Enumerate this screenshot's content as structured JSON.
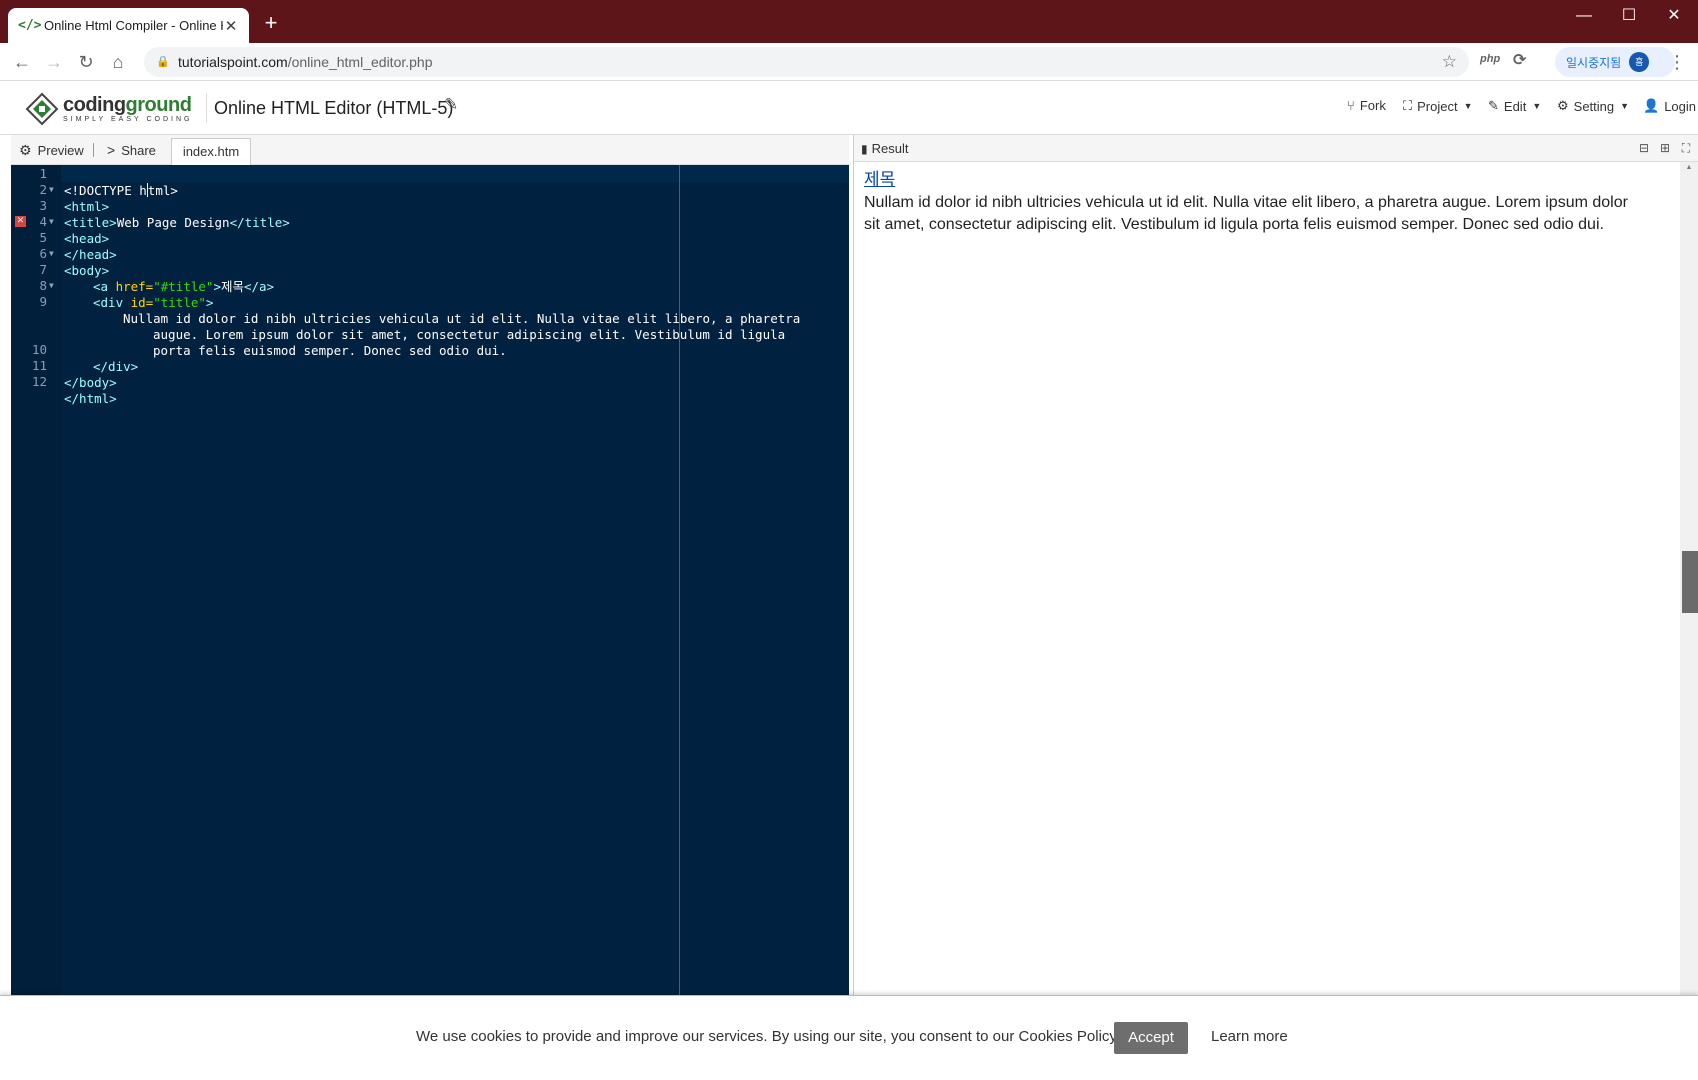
{
  "browser": {
    "tab_title": "Online Html Compiler - Online H",
    "url_domain": "tutorialspoint.com",
    "url_path": "/online_html_editor.php",
    "profile_label": "일시중지됨",
    "profile_avatar": "흠",
    "extension_label": "php"
  },
  "header": {
    "logo_main": "coding",
    "logo_accent": "ground",
    "logo_tagline": "SIMPLY EASY CODING",
    "page_title": "Online HTML Editor (HTML-5)",
    "menu": {
      "fork": "Fork",
      "project": "Project",
      "edit": "Edit",
      "setting": "Setting",
      "login": "Login"
    }
  },
  "editor": {
    "preview_label": "Preview",
    "share_label": "Share",
    "file_tab": "index.htm",
    "lines": [
      {
        "n": "1",
        "fold": false,
        "error": false
      },
      {
        "n": "2",
        "fold": true,
        "error": false
      },
      {
        "n": "3",
        "fold": false,
        "error": false
      },
      {
        "n": "4",
        "fold": true,
        "error": true
      },
      {
        "n": "5",
        "fold": false,
        "error": false
      },
      {
        "n": "6",
        "fold": true,
        "error": false
      },
      {
        "n": "7",
        "fold": false,
        "error": false
      },
      {
        "n": "8",
        "fold": true,
        "error": false
      },
      {
        "n": "9",
        "fold": false,
        "error": false
      },
      {
        "n": "10",
        "fold": false,
        "error": false
      },
      {
        "n": "11",
        "fold": false,
        "error": false
      },
      {
        "n": "12",
        "fold": false,
        "error": false
      }
    ],
    "code": {
      "l1a": "<!DOCTYPE h",
      "l1b": "tml>",
      "l2": "<html>",
      "l3_open": "<title>",
      "l3_text": "Web Page Design",
      "l3_close": "</title>",
      "l4": "<head>",
      "l5": "</head>",
      "l6": "<body>",
      "l7_open": "<a ",
      "l7_attr": "href=",
      "l7_val": "\"#title\"",
      "l7_gt": ">",
      "l7_text": "제목",
      "l7_close": "</a>",
      "l8_open": "<div ",
      "l8_attr": "id=",
      "l8_val": "\"title\"",
      "l8_gt": ">",
      "l9_a": "Nullam id dolor id nibh ultricies vehicula ut id elit. Nulla vitae elit libero, a pharetra",
      "l9_b": "augue. Lorem ipsum dolor sit amet, consectetur adipiscing elit. Vestibulum id ligula",
      "l9_c": "porta felis euismod semper. Donec sed odio dui.",
      "l10": "</div>",
      "l11": "</body>",
      "l12": "</html>"
    }
  },
  "result": {
    "title": "Result",
    "link_text": "제목",
    "body_line1": "Nullam id dolor id nibh ultricies vehicula ut id elit. Nulla vitae elit libero, a pharetra augue. Lorem ipsum dolor",
    "body_line2": "sit amet, consectetur adipiscing elit. Vestibulum id ligula porta felis euismod semper. Donec sed odio dui."
  },
  "cookie": {
    "message": "We use cookies to provide and improve our services. By using our site, you consent to our Cookies Policy.",
    "accept_label": "Accept",
    "learn_more_label": "Learn more"
  },
  "colors": {
    "tabbar": "#5e1519",
    "editor_bg": "#002240",
    "tag": "#9effff",
    "attribute": "#ffd700",
    "string": "#3ad900",
    "accent_green": "#2e7d32"
  }
}
